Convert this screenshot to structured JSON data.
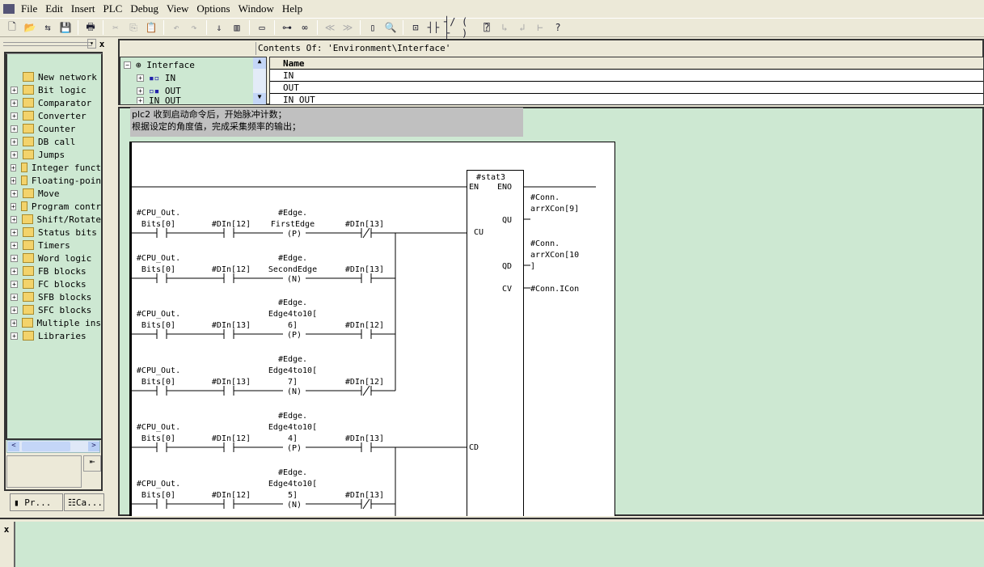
{
  "menu": [
    "File",
    "Edit",
    "Insert",
    "PLC",
    "Debug",
    "View",
    "Options",
    "Window",
    "Help"
  ],
  "toolbar": [
    [
      "new-icon",
      "🗋"
    ],
    [
      "open-icon",
      "📂"
    ],
    [
      "network-icon",
      "⇆"
    ],
    [
      "save-icon",
      "💾"
    ],
    [
      "print-icon",
      "🖶"
    ],
    [
      "cut-icon",
      "✂"
    ],
    [
      "copy-icon",
      "⎘"
    ],
    [
      "paste-icon",
      "📋"
    ],
    [
      "undo-icon",
      "↶"
    ],
    [
      "redo-icon",
      "↷"
    ],
    [
      "download-icon",
      "⇓"
    ],
    [
      "monitor-icon",
      "▥"
    ],
    [
      "window-icon",
      "▭"
    ],
    [
      "accessible-nodes-icon",
      "⊶"
    ],
    [
      "glasses-icon",
      "∞"
    ],
    [
      "prev-icon",
      "≪"
    ],
    [
      "next-icon",
      "≫"
    ],
    [
      "overview-icon",
      "▯"
    ],
    [
      "details-icon",
      "🔍"
    ],
    [
      "new-network-icon",
      "⊡"
    ],
    [
      "no-contact-icon",
      "┤├"
    ],
    [
      "nc-contact-icon",
      "┤/├"
    ],
    [
      "coil-icon",
      "( )"
    ],
    [
      "box-icon",
      "⍰"
    ],
    [
      "branch-open-icon",
      "↳"
    ],
    [
      "branch-close-icon",
      "↲"
    ],
    [
      "connection-icon",
      "⊢"
    ],
    [
      "help-icon",
      "?"
    ]
  ],
  "left_panel": {
    "items": [
      {
        "label": "New network",
        "icon": "new-network-icon",
        "expandable": false
      },
      {
        "label": "Bit logic",
        "icon": "bit-logic-icon"
      },
      {
        "label": "Comparator",
        "icon": "comparator-icon"
      },
      {
        "label": "Converter",
        "icon": "converter-icon"
      },
      {
        "label": "Counter",
        "icon": "counter-icon"
      },
      {
        "label": "DB call",
        "icon": "db-call-icon"
      },
      {
        "label": "Jumps",
        "icon": "jumps-icon"
      },
      {
        "label": "Integer funct",
        "icon": "integer-icon"
      },
      {
        "label": "Floating-poin",
        "icon": "floating-icon"
      },
      {
        "label": "Move",
        "icon": "move-icon"
      },
      {
        "label": "Program contr",
        "icon": "program-control-icon"
      },
      {
        "label": "Shift/Rotate",
        "icon": "shift-icon"
      },
      {
        "label": "Status bits",
        "icon": "status-bits-icon"
      },
      {
        "label": "Timers",
        "icon": "timer-icon"
      },
      {
        "label": "Word logic",
        "icon": "word-logic-icon"
      },
      {
        "label": "FB blocks",
        "icon": "fb-block-icon"
      },
      {
        "label": "FC blocks",
        "icon": "fc-block-icon"
      },
      {
        "label": "SFB blocks",
        "icon": "sfb-block-icon"
      },
      {
        "label": "SFC blocks",
        "icon": "sfc-block-icon"
      },
      {
        "label": "Multiple ins",
        "icon": "multiple-instance-icon"
      },
      {
        "label": "Libraries",
        "icon": "libraries-icon"
      }
    ],
    "tabs": [
      "Pr...",
      "Ca..."
    ]
  },
  "interface": {
    "contents_of": "Contents Of: 'Environment\\Interface'",
    "tree": [
      "Interface",
      "IN",
      "OUT",
      "IN_OUT"
    ],
    "column_header": "Name",
    "rows": [
      "IN",
      "OUT",
      "IN_OUT"
    ]
  },
  "network": {
    "comment": [
      "plc2 收到启动命令后，开始脉冲计数；",
      "根据设定的角度值，完成采集频率的输出；"
    ],
    "block": {
      "name": "#stat3",
      "en": "EN",
      "eno": "ENO",
      "inputs": [
        "CU",
        "CD"
      ],
      "outputs": [
        "QU",
        "QD",
        "CV"
      ],
      "output_labels": [
        [
          "#Conn.",
          "arrXCon[9]"
        ],
        [
          "#Conn.",
          "arrXCon[10",
          "]"
        ],
        [
          "#Conn.ICon"
        ]
      ]
    },
    "rungs": [
      {
        "c1": [
          "#CPU_Out.",
          "Bits[0]"
        ],
        "c2": "#DIn[12]",
        "coil": [
          "#Edge.",
          "FirstEdge"
        ],
        "edge": "P",
        "c4": "#DIn[13]",
        "c4_nc": true
      },
      {
        "c1": [
          "#CPU_Out.",
          "Bits[0]"
        ],
        "c2": "#DIn[12]",
        "coil": [
          "#Edge.",
          "SecondEdge"
        ],
        "edge": "N",
        "c4": "#DIn[13]",
        "c4_nc": false
      },
      {
        "c1": [
          "#CPU_Out.",
          "Bits[0]"
        ],
        "c2": "#DIn[13]",
        "coil": [
          "#Edge.",
          "Edge4to10[",
          "6]"
        ],
        "edge": "P",
        "c4": "#DIn[12]",
        "c4_nc": false
      },
      {
        "c1": [
          "#CPU_Out.",
          "Bits[0]"
        ],
        "c2": "#DIn[13]",
        "coil": [
          "#Edge.",
          "Edge4to10[",
          "7]"
        ],
        "edge": "N",
        "c4": "#DIn[12]",
        "c4_nc": true
      },
      {
        "c1": [
          "#CPU_Out.",
          "Bits[0]"
        ],
        "c2": "#DIn[12]",
        "coil": [
          "#Edge.",
          "Edge4to10[",
          "4]"
        ],
        "edge": "P",
        "c4": "#DIn[13]",
        "c4_nc": false
      },
      {
        "c1": [
          "#CPU_Out.",
          "Bits[0]"
        ],
        "c2": "#DIn[12]",
        "coil": [
          "#Edge.",
          "Edge4to10[",
          "5]"
        ],
        "edge": "N",
        "c4": "#DIn[13]",
        "c4_nc": true
      }
    ]
  },
  "colors": {
    "editor_bg": "#cde8d2",
    "comment_bg": "#c0c0c0"
  }
}
